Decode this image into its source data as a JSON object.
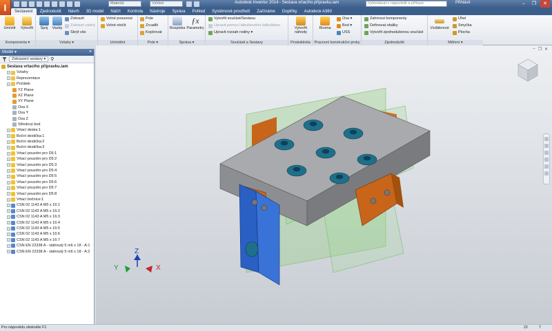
{
  "app": {
    "logo": "I",
    "title": "Autodesk Inventor 2014 - Sestava vrtacího přípravku.iam"
  },
  "qat": {
    "material": "Materiál",
    "appearance": "Vzhled"
  },
  "search": {
    "placeholder": "Vyhledávat v nápovědě a příkaze"
  },
  "user": {
    "login": "Přihlásit"
  },
  "window_controls": {
    "minimize": "–",
    "restore": "❐",
    "close": "✕"
  },
  "tabs": [
    "Sestavení",
    "Zjednodušit",
    "Návrh",
    "3D model",
    "Náčrt",
    "Kontrola",
    "Nástroje",
    "Správa",
    "Pohled",
    "Systémové prostředí",
    "Začínáme",
    "Doplňky",
    "Autodesk A360"
  ],
  "ribbon": {
    "komponenta": {
      "title": "Komponenta ▾",
      "umistit": "Umístit",
      "vytvorit": "Vytvořit"
    },
    "vztahy": {
      "title": "Vztahy ▾",
      "spoj": "Spoj",
      "vazby": "Vazby",
      "zobrazit": "Zobrazit",
      "zobrazit_vadny": "Zobrazit vadný",
      "skryt_vse": "Skrýt vše"
    },
    "umisteni": {
      "title": "Umístění",
      "volne_posunout": "Volné posunout",
      "volne_otocit": "Volné otočit"
    },
    "pole": {
      "title": "Pole ▾",
      "pole": "Pole",
      "zrcadlit": "Zrcadlit",
      "kopirovat": "Kopírovat"
    },
    "sprava": {
      "title": "Správa ▾",
      "rozpiska": "Rozpiska",
      "parametry": "Parametry"
    },
    "soucasti": {
      "title": "Součásti a Sestavy",
      "vytvorit": "Vytvořit součást/Sestavu",
      "upravit_tab": "Upravit pomocí tabulkového kalkulátoru",
      "upravit_rodiny": "Upravit rozsah rodiny ▾"
    },
    "produktivita": {
      "title": "Produktivita",
      "vytvorit_nahody": "Vytvořit náhody"
    },
    "pracovni": {
      "title": "Pracovní konstrukční prvky",
      "rovina": "Rovina",
      "osa": "Osa ▾",
      "bod": "Bod ▾",
      "uss": "USS"
    },
    "zjednodusit": {
      "title": "Zjednodušit",
      "zahrnout": "Zahrnout komponenty",
      "definovat": "Definovat obálky",
      "vytvorit": "Vytvořit zjednodušenou součást"
    },
    "mereni": {
      "title": "Měření ▾",
      "vzdalenost": "Vzdálenost",
      "uhel": "Úhel",
      "smycka": "Smyčka",
      "plocha": "Plocha"
    }
  },
  "browser": {
    "title": "Model ▾",
    "view_selector": "Zobrazení sestavy ▾",
    "nodes": [
      {
        "label": "Sestava vrtacího přípravku.iam",
        "level": 0,
        "icon": "assembly-icon"
      },
      {
        "label": "Vztahy",
        "level": 1,
        "icon": "relationships-icon"
      },
      {
        "label": "Reprezentace",
        "level": 1,
        "icon": "representations-icon"
      },
      {
        "label": "Počátek",
        "level": 1,
        "icon": "origin-icon"
      },
      {
        "label": "YZ Plane",
        "level": 2,
        "icon": "plane-icon"
      },
      {
        "label": "XZ Plane",
        "level": 2,
        "icon": "plane-icon"
      },
      {
        "label": "XY Plane",
        "level": 2,
        "icon": "plane-icon"
      },
      {
        "label": "Osa X",
        "level": 2,
        "icon": "axis-icon"
      },
      {
        "label": "Osa Y",
        "level": 2,
        "icon": "axis-icon"
      },
      {
        "label": "Osa Z",
        "level": 2,
        "icon": "axis-icon"
      },
      {
        "label": "Středový bod",
        "level": 2,
        "icon": "point-icon"
      },
      {
        "label": "Vrtací deska:1",
        "level": 1,
        "icon": "part-icon"
      },
      {
        "label": "Boční destička:1",
        "level": 1,
        "icon": "part-icon"
      },
      {
        "label": "Boční destička:2",
        "level": 1,
        "icon": "part-icon"
      },
      {
        "label": "Boční destička:3",
        "level": 1,
        "icon": "part-icon"
      },
      {
        "label": "Vrtací pouzdro pro D5:1",
        "level": 1,
        "icon": "part-icon"
      },
      {
        "label": "Vrtací pouzdro pro D5:2",
        "level": 1,
        "icon": "part-icon"
      },
      {
        "label": "Vrtací pouzdro pro D5:3",
        "level": 1,
        "icon": "part-icon"
      },
      {
        "label": "Vrtací pouzdro pro D5:4",
        "level": 1,
        "icon": "part-icon"
      },
      {
        "label": "Vrtací pouzdro pro D5:5",
        "level": 1,
        "icon": "part-icon"
      },
      {
        "label": "Vrtací pouzdro pro D5:6",
        "level": 1,
        "icon": "part-icon"
      },
      {
        "label": "Vrtací pouzdro pro D5:7",
        "level": 1,
        "icon": "part-icon"
      },
      {
        "label": "Vrtací pouzdro pro D5:8",
        "level": 1,
        "icon": "part-icon"
      },
      {
        "label": "Vrtací bočnice:1",
        "level": 1,
        "icon": "part-icon"
      },
      {
        "label": "CSN 02 1143 A M5 x 16:1",
        "level": 1,
        "icon": "bolt-icon"
      },
      {
        "label": "CSN 02 1143 A M5 x 16:2",
        "level": 1,
        "icon": "bolt-icon"
      },
      {
        "label": "CSN 02 1143 A M5 x 16:3",
        "level": 1,
        "icon": "bolt-icon"
      },
      {
        "label": "CSN 02 1143 A M5 x 16:4",
        "level": 1,
        "icon": "bolt-icon"
      },
      {
        "label": "CSN 02 1143 A M5 x 16:5",
        "level": 1,
        "icon": "bolt-icon"
      },
      {
        "label": "CSN 02 1143 A M5 x 16:6",
        "level": 1,
        "icon": "bolt-icon"
      },
      {
        "label": "CSN 02 1143 A M5 x 16:7",
        "level": 1,
        "icon": "bolt-icon"
      },
      {
        "label": "CSN EN 22338 A - stáhnutý 5 m6 x 18 - A:1",
        "level": 1,
        "icon": "pin-icon"
      },
      {
        "label": "CSN EN 22338 A - stáhnutý 5 m6 x 18 - A:2",
        "level": 1,
        "icon": "pin-icon"
      }
    ]
  },
  "triad": {
    "x": "X",
    "y": "Y",
    "z": "Z"
  },
  "status": {
    "text": "Pro nápovědu stiskněte F1",
    "count_a": "22",
    "count_b": "7"
  },
  "colors": {
    "accent": "#3d5f8c",
    "bushing": "#1f6f8b",
    "plate": "#9a9b9e",
    "side_block": "#c86418",
    "side_plate": "#2a5fc4",
    "work_plane": "#7cc36c"
  }
}
